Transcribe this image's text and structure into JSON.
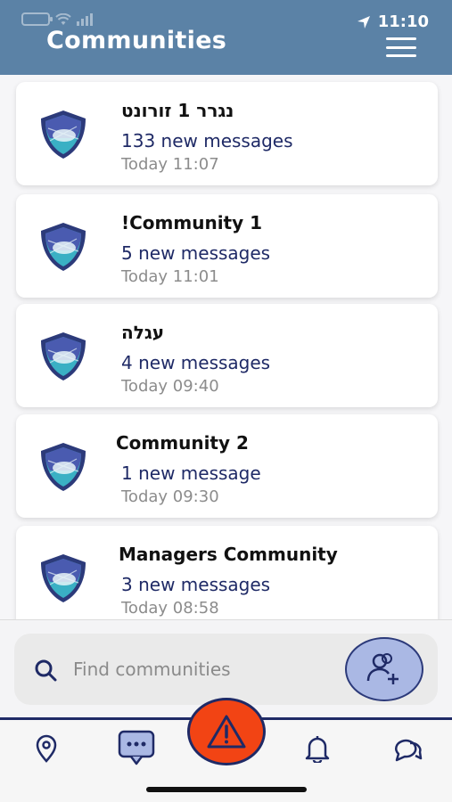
{
  "status_bar": {
    "time": "11:10"
  },
  "header": {
    "title": "Communities"
  },
  "communities": [
    {
      "title": "נגרר 1 זורונט",
      "rtl": true,
      "count": "133 new messages",
      "stamp": "Today 11:07"
    },
    {
      "title": "!Community 1",
      "rtl": false,
      "count": "5 new messages",
      "stamp": "Today 11:01"
    },
    {
      "title": "עגלה",
      "rtl": true,
      "count": "4 new messages",
      "stamp": "Today 09:40"
    },
    {
      "title": "Community 2",
      "rtl": false,
      "count": "1 new message",
      "stamp": "Today 09:30"
    },
    {
      "title": "Managers Community",
      "rtl": false,
      "count": "3 new messages",
      "stamp": "Today 08:58"
    }
  ],
  "search": {
    "placeholder": "Find communities",
    "value": ""
  },
  "icons": {
    "menu": "hamburger-icon",
    "search": "search-icon",
    "add": "add-user-icon",
    "sos": "warning-icon",
    "tabs": [
      "location-pin-icon",
      "chat-icon",
      "bell-icon",
      "chat-bubbles-icon"
    ]
  },
  "colors": {
    "header": "#5b82a6",
    "accent": "#1f2a66",
    "sos": "#f24414",
    "add_button": "#aab8e4",
    "stamp": "#8c8c8c"
  }
}
